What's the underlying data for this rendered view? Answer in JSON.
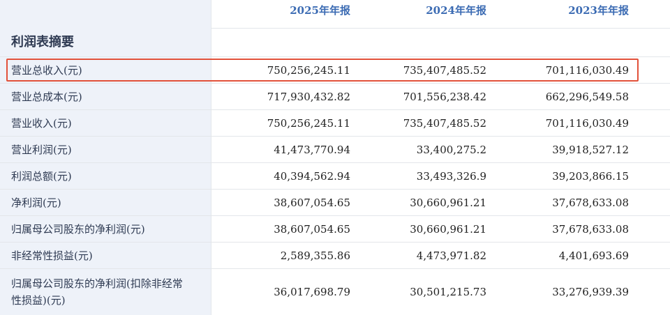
{
  "header": {
    "col1": "2025年年报",
    "col2": "2024年年报",
    "col3": "2023年年报"
  },
  "section_title": "利润表摘要",
  "rows": [
    {
      "label": "营业总收入(元)",
      "v2025": "750,256,245.11",
      "v2024": "735,407,485.52",
      "v2023": "701,116,030.49"
    },
    {
      "label": "营业总成本(元)",
      "v2025": "717,930,432.82",
      "v2024": "701,556,238.42",
      "v2023": "662,296,549.58"
    },
    {
      "label": "营业收入(元)",
      "v2025": "750,256,245.11",
      "v2024": "735,407,485.52",
      "v2023": "701,116,030.49"
    },
    {
      "label": "营业利润(元)",
      "v2025": "41,473,770.94",
      "v2024": "33,400,275.2",
      "v2023": "39,918,527.12"
    },
    {
      "label": "利润总额(元)",
      "v2025": "40,394,562.94",
      "v2024": "33,493,326.9",
      "v2023": "39,203,866.15"
    },
    {
      "label": "净利润(元)",
      "v2025": "38,607,054.65",
      "v2024": "30,660,961.21",
      "v2023": "37,678,633.08"
    },
    {
      "label": "归属母公司股东的净利润(元)",
      "v2025": "38,607,054.65",
      "v2024": "30,660,961.21",
      "v2023": "37,678,633.08"
    },
    {
      "label": "非经常性损益(元)",
      "v2025": "2,589,355.86",
      "v2024": "4,473,971.82",
      "v2023": "4,401,693.69"
    },
    {
      "label_line1": "归属母公司股东的净利润(扣除非经常",
      "label_line2": "性损益)(元)",
      "v2025": "36,017,698.79",
      "v2024": "30,501,215.73",
      "v2023": "33,276,939.39"
    }
  ],
  "colors": {
    "accent": "#3b6bb3",
    "highlight_border": "#e2513a",
    "label_bg": "#eef2f9"
  }
}
